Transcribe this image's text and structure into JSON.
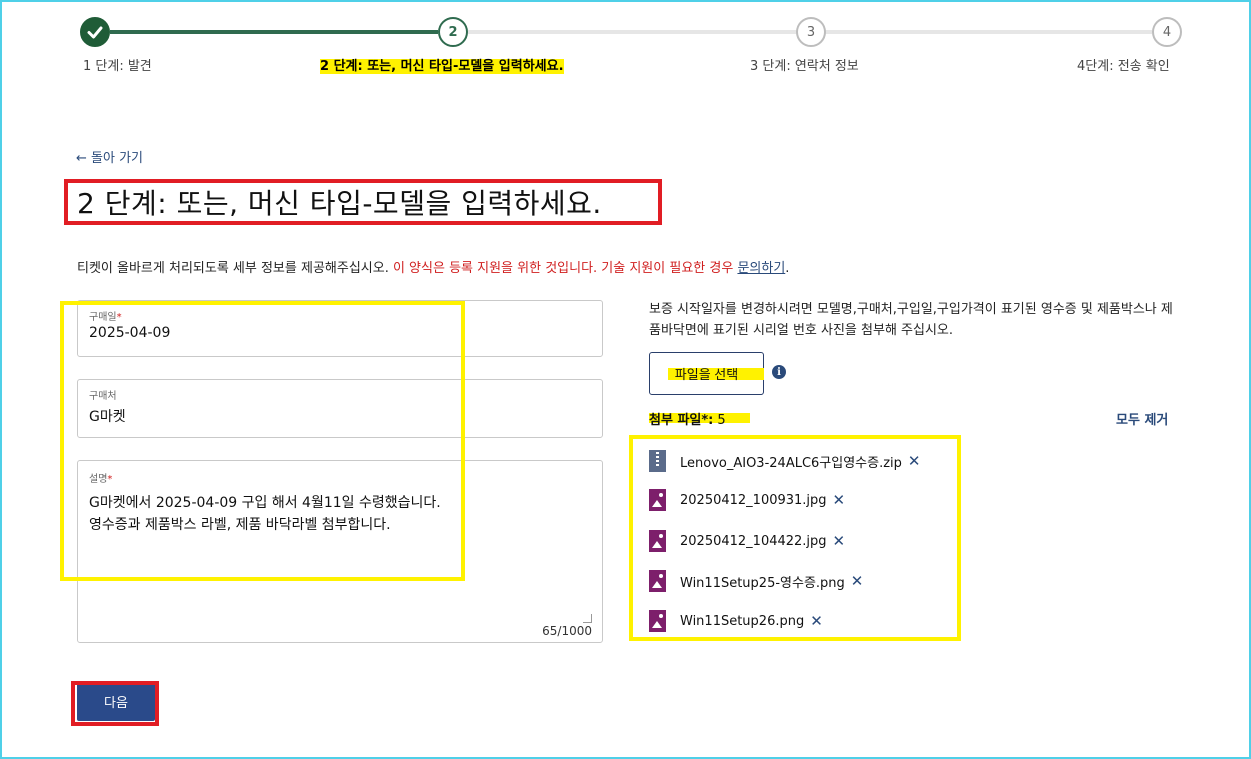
{
  "stepper": {
    "steps": [
      {
        "number": "",
        "label": "1 단계: 발견",
        "state": "done"
      },
      {
        "number": "2",
        "label": "2 단계: 또는, 머신 타입-모델을 입력하세요.",
        "state": "current"
      },
      {
        "number": "3",
        "label": "3 단계: 연락처 정보",
        "state": "todo"
      },
      {
        "number": "4",
        "label": "4단계: 전송 확인",
        "state": "todo"
      }
    ]
  },
  "back_link": "← 돌아 가기",
  "page_title": "2 단계: 또는, 머신 타입-모델을 입력하세요.",
  "notice": {
    "text": "티켓이 올바르게 처리되도록 세부 정보를 제공해주십시오. ",
    "warning": "이 양식은 등록 지원을 위한 것입니다. 기술 지원이 필요한 경우 ",
    "link": "문의하기",
    "period": "."
  },
  "form": {
    "purchase_date": {
      "label": "구매일",
      "required": "*",
      "value": "2025-04-09"
    },
    "store": {
      "label": "구매처",
      "value": "G마켓"
    },
    "description": {
      "label": "설명",
      "required": "*",
      "value": "G마켓에서 2025-04-09 구입 해서 4월11일 수령했습니다.\n영수증과 제품박스 라벨, 제품 바닥라벨 첨부합니다.",
      "counter": "65/1000"
    }
  },
  "attachments": {
    "help_text": "보증 시작일자를 변경하시려면 모델명,구매처,구입일,구입가격이 표기된 영수증 및 제품박스나 제품바닥면에 표기된 시리얼 번호 사진을 첨부해 주십시오.",
    "choose_button": "파일을 선택",
    "info_icon": "i",
    "label": "첨부 파일*:",
    "count": "5",
    "remove_all": "모두 제거",
    "files": [
      {
        "name": "Lenovo_AIO3-24ALC6구입영수증.zip",
        "icon": "zip-file-icon"
      },
      {
        "name": "20250412_100931.jpg",
        "icon": "image-file-icon"
      },
      {
        "name": "20250412_104422.jpg",
        "icon": "image-file-icon"
      },
      {
        "name": "Win11Setup25-영수증.png",
        "icon": "image-file-icon"
      },
      {
        "name": "Win11Setup26.png",
        "icon": "image-file-icon"
      }
    ],
    "remove_glyph": "✕"
  },
  "next_button": "다음",
  "colors": {
    "accent_blue": "#2a4a8a",
    "step_green": "#1f5c37",
    "annotation_red": "#e11d24",
    "annotation_yellow": "#fff200",
    "warning_red": "#d02020"
  }
}
